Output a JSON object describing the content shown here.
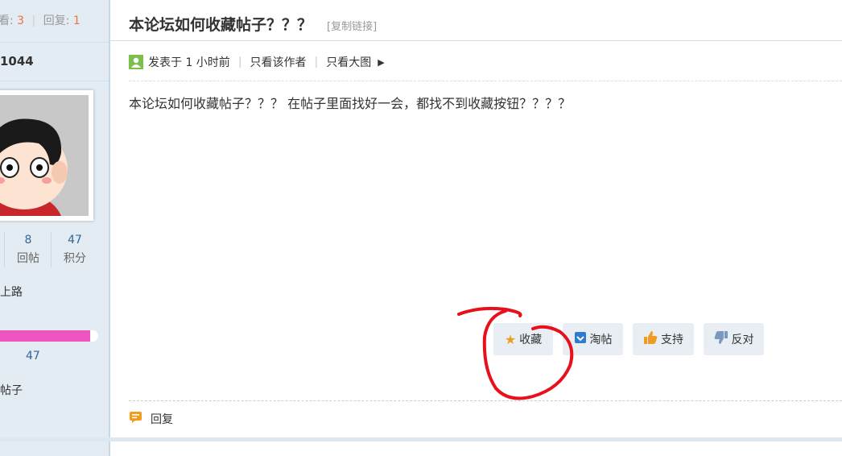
{
  "sidebar": {
    "views_label_fragment": "看:",
    "views_count": "3",
    "replies_label": "回复:",
    "replies_count": "1",
    "username_fragment": "1044",
    "stats": [
      {
        "value": "",
        "label": ""
      },
      {
        "value": "8",
        "label": "回帖"
      },
      {
        "value": "47",
        "label": "积分"
      }
    ],
    "rank_fragment": "上路",
    "progress_value": "47",
    "progress_fraction": 0.92,
    "extra_fragment": "帖子"
  },
  "post": {
    "title": "本论坛如何收藏帖子？？？",
    "copy_link": "[复制链接]",
    "posted": "发表于 1 小时前",
    "only_author": "只看该作者",
    "big_image": "只看大图",
    "content": "本论坛如何收藏帖子？？？  在帖子里面找好一会，都找不到收藏按钮？？？？"
  },
  "actions": {
    "favorite": "收藏",
    "taobao": "淘帖",
    "support": "支持",
    "oppose": "反对"
  },
  "footer": {
    "reply": "回复"
  },
  "colors": {
    "sidebar_bg": "#e3ecf3",
    "progress": "#ee55c0",
    "highlight_circle": "#e8101a"
  }
}
